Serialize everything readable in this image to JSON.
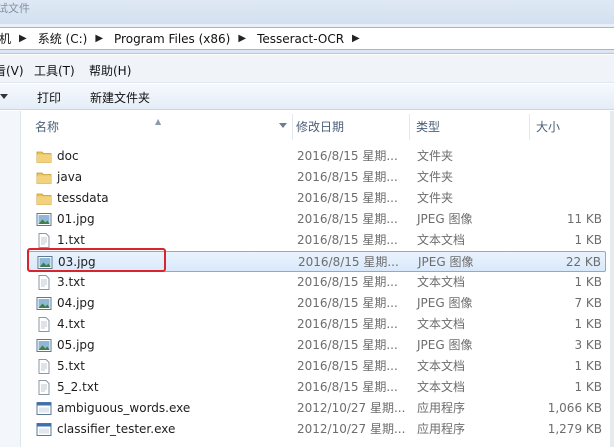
{
  "titlebar": {
    "text": "测试文件"
  },
  "addressbar": {
    "crumbs": [
      "机",
      "系统 (C:)",
      "Program Files (x86)",
      "Tesseract-OCR"
    ]
  },
  "menubar": {
    "items": [
      "看(V)",
      "工具(T)",
      "帮助(H)"
    ]
  },
  "toolbar": {
    "buttons": [
      "打印",
      "新建文件夹"
    ]
  },
  "columns": {
    "name": "名称",
    "date": "修改日期",
    "type": "类型",
    "size": "大小"
  },
  "rows": [
    {
      "name": "doc",
      "icon": "folder-icon",
      "date": "2016/8/15 星期...",
      "type": "文件夹",
      "size": ""
    },
    {
      "name": "java",
      "icon": "folder-icon",
      "date": "2016/8/15 星期...",
      "type": "文件夹",
      "size": ""
    },
    {
      "name": "tessdata",
      "icon": "folder-icon",
      "date": "2016/8/15 星期...",
      "type": "文件夹",
      "size": ""
    },
    {
      "name": "01.jpg",
      "icon": "image-file-icon",
      "date": "2016/8/15 星期...",
      "type": "JPEG 图像",
      "size": "11 KB"
    },
    {
      "name": "1.txt",
      "icon": "text-file-icon",
      "date": "2016/8/15 星期...",
      "type": "文本文档",
      "size": "1 KB"
    },
    {
      "name": "03.jpg",
      "icon": "image-file-icon",
      "date": "2016/8/15 星期...",
      "type": "JPEG 图像",
      "size": "22 KB",
      "selected": true
    },
    {
      "name": "3.txt",
      "icon": "text-file-icon",
      "date": "2016/8/15 星期...",
      "type": "文本文档",
      "size": "1 KB"
    },
    {
      "name": "04.jpg",
      "icon": "image-file-icon",
      "date": "2016/8/15 星期...",
      "type": "JPEG 图像",
      "size": "7 KB"
    },
    {
      "name": "4.txt",
      "icon": "text-file-icon",
      "date": "2016/8/15 星期...",
      "type": "文本文档",
      "size": "1 KB"
    },
    {
      "name": "05.jpg",
      "icon": "image-file-icon",
      "date": "2016/8/15 星期...",
      "type": "JPEG 图像",
      "size": "3 KB"
    },
    {
      "name": "5.txt",
      "icon": "text-file-icon",
      "date": "2016/8/15 星期...",
      "type": "文本文档",
      "size": "1 KB"
    },
    {
      "name": "5_2.txt",
      "icon": "text-file-icon",
      "date": "2016/8/15 星期...",
      "type": "文本文档",
      "size": "1 KB"
    },
    {
      "name": "ambiguous_words.exe",
      "icon": "exe-file-icon",
      "date": "2012/10/27 星期...",
      "type": "应用程序",
      "size": "1,066 KB"
    },
    {
      "name": "classifier_tester.exe",
      "icon": "exe-file-icon",
      "date": "2012/10/27 星期...",
      "type": "应用程序",
      "size": "1,279 KB"
    }
  ],
  "colors": {
    "selection_border": "#84acdd",
    "annotation_box": "#d6262b",
    "folder": "#e8c262"
  }
}
